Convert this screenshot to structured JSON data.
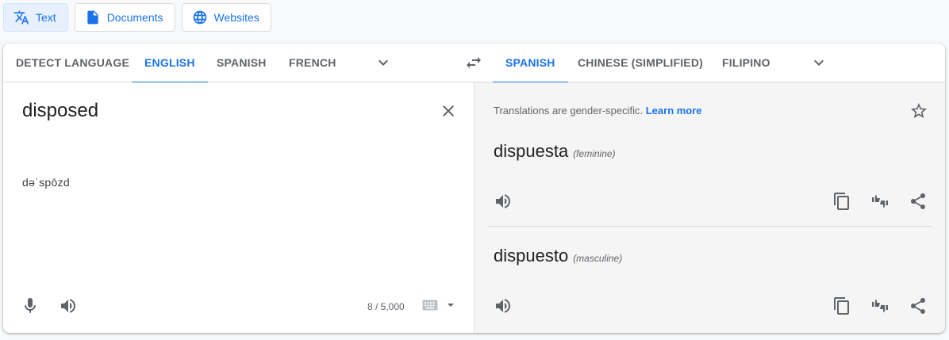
{
  "modes": {
    "text": "Text",
    "documents": "Documents",
    "websites": "Websites"
  },
  "source_langs": {
    "detect": "DETECT LANGUAGE",
    "english": "ENGLISH",
    "spanish": "SPANISH",
    "french": "FRENCH"
  },
  "target_langs": {
    "spanish": "SPANISH",
    "chinese": "CHINESE (SIMPLIFIED)",
    "filipino": "FILIPINO"
  },
  "source": {
    "text": "disposed",
    "transliteration": "dəˈspōzd",
    "char_count": "8 / 5,000"
  },
  "target": {
    "gender_note": "Translations are gender-specific.",
    "learn_more": "Learn more",
    "translations": [
      {
        "word": "dispuesta",
        "gender": "(feminine)"
      },
      {
        "word": "dispuesto",
        "gender": "(masculine)"
      }
    ]
  },
  "colors": {
    "accent": "#1a73e8",
    "icon": "#5f6368",
    "target_bg": "#f5f5f5"
  }
}
